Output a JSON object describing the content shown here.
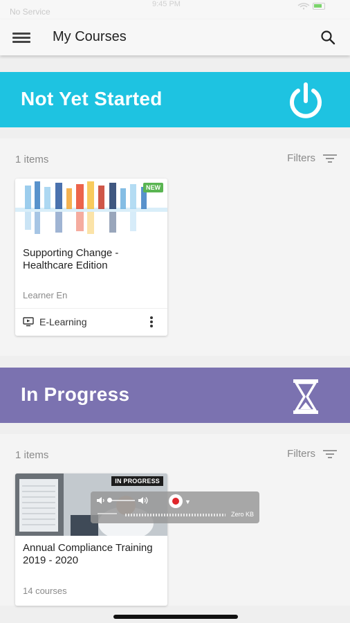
{
  "status_bar": {
    "carrier": "No Service",
    "time": "9:45 PM"
  },
  "header": {
    "title": "My Courses",
    "menu_icon": "hamburger-menu-icon",
    "search_icon": "search-icon"
  },
  "sections": [
    {
      "title": "Not Yet Started",
      "color": "#1ec3e1",
      "icon": "power-icon",
      "count": "1 items",
      "filters_label": "Filters",
      "course": {
        "name": "Supporting Change - Healthcare Edition",
        "badge": "NEW",
        "subtitle": "Learner En",
        "type_label": "E-Learning",
        "type_icon": "monitor-play-icon"
      }
    },
    {
      "title": "In Progress",
      "color": "#7b72b0",
      "icon": "hourglass-icon",
      "count": "1 items",
      "filters_label": "Filters",
      "course": {
        "name": "Annual Compliance Training 2019 - 2020",
        "badge": "IN PROGRESS",
        "subtitle": "14 courses"
      }
    }
  ],
  "recorder_overlay": {
    "size_label": "Zero KB",
    "record_color": "#e0262b"
  }
}
